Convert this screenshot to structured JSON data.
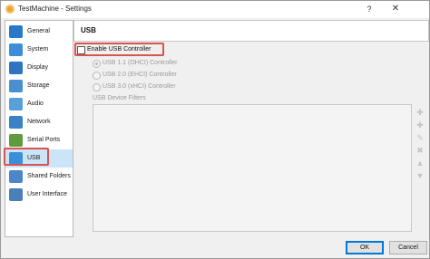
{
  "window": {
    "title": "TestMachine - Settings",
    "help_label": "?",
    "close_label": "✕"
  },
  "sidebar": {
    "items": [
      {
        "label": "General",
        "icon": "general-icon",
        "color": "#2a78c8"
      },
      {
        "label": "System",
        "icon": "system-icon",
        "color": "#3c8fd6"
      },
      {
        "label": "Display",
        "icon": "display-icon",
        "color": "#2f74c0"
      },
      {
        "label": "Storage",
        "icon": "storage-icon",
        "color": "#4a90d0"
      },
      {
        "label": "Audio",
        "icon": "audio-icon",
        "color": "#5aa0d8"
      },
      {
        "label": "Network",
        "icon": "network-icon",
        "color": "#3b82c4"
      },
      {
        "label": "Serial Ports",
        "icon": "serial-ports-icon",
        "color": "#5c9c3c"
      },
      {
        "label": "USB",
        "icon": "usb-icon",
        "color": "#3a8fd8",
        "selected": true
      },
      {
        "label": "Shared Folders",
        "icon": "shared-folders-icon",
        "color": "#4a86c8"
      },
      {
        "label": "User Interface",
        "icon": "user-interface-icon",
        "color": "#4a7fb8"
      }
    ]
  },
  "page": {
    "title": "USB",
    "enable_usb": {
      "label": "Enable USB Controller",
      "checked": false
    },
    "usb_versions": [
      {
        "label": "USB 1.1 (OHCI) Controller",
        "checked": true
      },
      {
        "label": "USB 2.0 (EHCI) Controller",
        "checked": false
      },
      {
        "label": "USB 3.0 (xHCI) Controller",
        "checked": false
      }
    ],
    "filters_label": "USB Device Filters"
  },
  "buttons": {
    "ok": "OK",
    "cancel": "Cancel"
  },
  "colors": {
    "selection": "#cce4f7",
    "highlight": "#d9534f"
  }
}
